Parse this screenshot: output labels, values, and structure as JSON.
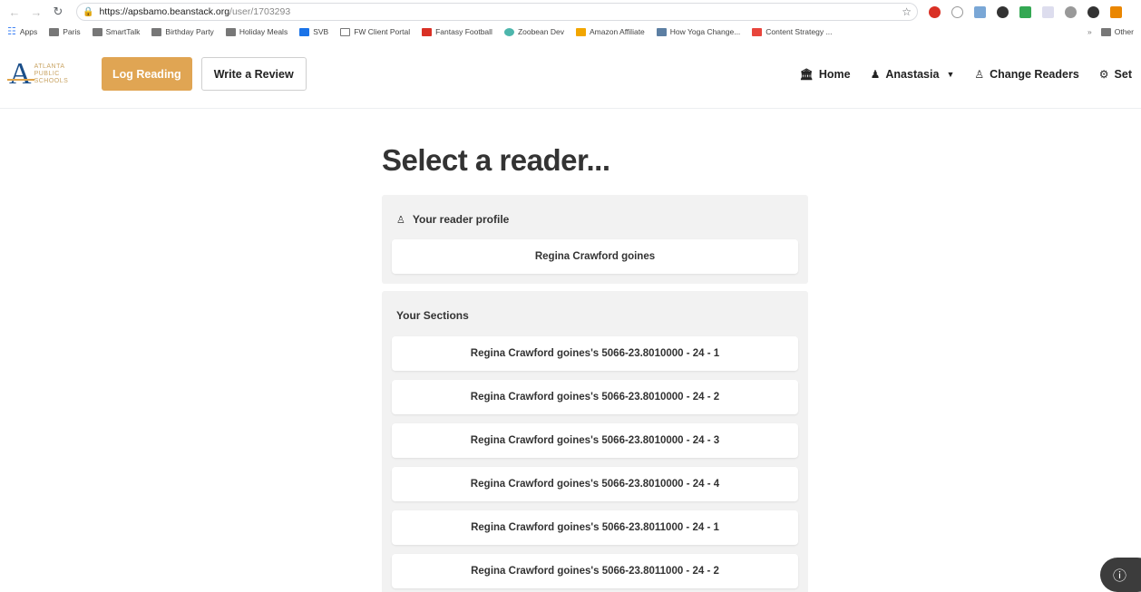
{
  "browser": {
    "url_host": "https://apsbamo.beanstack.org",
    "url_path": "/user/1703293",
    "bookmarks": [
      {
        "label": "Apps",
        "icon": "apps-grid-icon"
      },
      {
        "label": "Paris",
        "icon": "folder-icon"
      },
      {
        "label": "SmartTalk",
        "icon": "folder-icon"
      },
      {
        "label": "Birthday Party",
        "icon": "folder-icon"
      },
      {
        "label": "Holiday Meals",
        "icon": "folder-icon"
      },
      {
        "label": "SVB",
        "icon": "site-icon"
      },
      {
        "label": "FW Client Portal",
        "icon": "page-icon"
      },
      {
        "label": "Fantasy Football",
        "icon": "site-icon"
      },
      {
        "label": "Zoobean Dev",
        "icon": "heart-icon"
      },
      {
        "label": "Amazon Affiliate",
        "icon": "site-icon"
      },
      {
        "label": "How Yoga Change...",
        "icon": "site-icon"
      },
      {
        "label": "Content Strategy ...",
        "icon": "site-icon"
      }
    ],
    "other_bookmarks": "Other"
  },
  "header": {
    "logo_lines": [
      "ATLANTA",
      "PUBLIC",
      "SCHOOLS"
    ],
    "log_reading_label": "Log Reading",
    "write_review_label": "Write a Review",
    "nav": {
      "home": "Home",
      "user": "Anastasia",
      "change_readers": "Change Readers",
      "settings": "Set"
    }
  },
  "page": {
    "title": "Select a reader...",
    "profile_section_label": "Your reader profile",
    "profile_name": "Regina Crawford goines",
    "sections_label": "Your Sections",
    "sections": [
      "Regina Crawford goines's 5066-23.8010000 - 24 - 1",
      "Regina Crawford goines's 5066-23.8010000 - 24 - 2",
      "Regina Crawford goines's 5066-23.8010000 - 24 - 3",
      "Regina Crawford goines's 5066-23.8010000 - 24 - 4",
      "Regina Crawford goines's 5066-23.8011000 - 24 - 1",
      "Regina Crawford goines's 5066-23.8011000 - 24 - 2"
    ]
  },
  "colors": {
    "accent": "#e0a553",
    "panel_bg": "#f2f2f2"
  }
}
